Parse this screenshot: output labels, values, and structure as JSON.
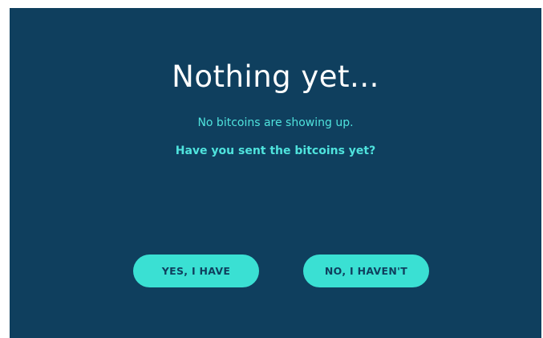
{
  "screen": {
    "title": "Nothing yet...",
    "subtitle": "No bitcoins are showing up.",
    "question": "Have you sent the bitcoins yet?"
  },
  "buttons": {
    "yes_label": "YES, I HAVE",
    "no_label": "NO, I HAVEN'T"
  },
  "colors": {
    "background": "#0f3f5e",
    "accent": "#3ae0d3",
    "text_accent": "#4fe3dd",
    "title": "#ffffff"
  }
}
